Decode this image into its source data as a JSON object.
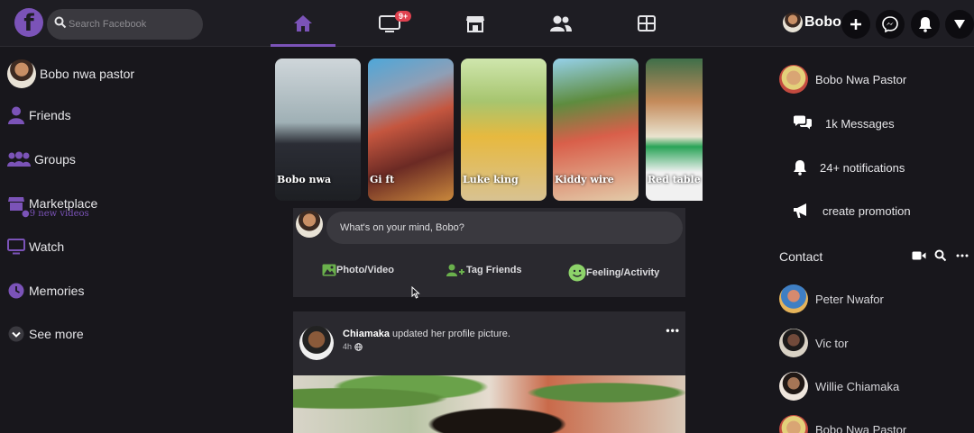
{
  "search": {
    "placeholder": "Search Facebook"
  },
  "nav": {
    "watch_badge": "9+"
  },
  "profile": {
    "top_name": "Bobo"
  },
  "left_menu": {
    "user": "Bobo nwa pastor",
    "items": [
      "Friends",
      "Groups",
      "Marketplace",
      "Watch",
      "Memories",
      "See more"
    ],
    "watch_sub": "●9 new videos"
  },
  "stories": [
    "Bobo nwa",
    "Gi ft",
    "Luke king",
    "Kiddy wire",
    "Red table"
  ],
  "composer": {
    "placeholder": "What's on your mind, Bobo?",
    "photo": "Photo/Video",
    "tag": "Tag Friends",
    "feeling": "Feeling/Activity"
  },
  "post": {
    "author": "Chiamaka",
    "action": " updated her profile picture.",
    "time": "4h",
    "more": "•••"
  },
  "right_menu": {
    "user": "Bobo Nwa Pastor",
    "messages": "1k Messages",
    "notifications": "24+ notifications",
    "promotion": "create promotion"
  },
  "contacts": {
    "title": "Contact",
    "list": [
      "Peter Nwafor",
      "Vic tor",
      "Willie Chiamaka",
      "Bobo Nwa Pastor"
    ]
  },
  "colors": {
    "accent": "#7b53b8",
    "badge": "#e0414f",
    "green": "#8dd36a"
  }
}
